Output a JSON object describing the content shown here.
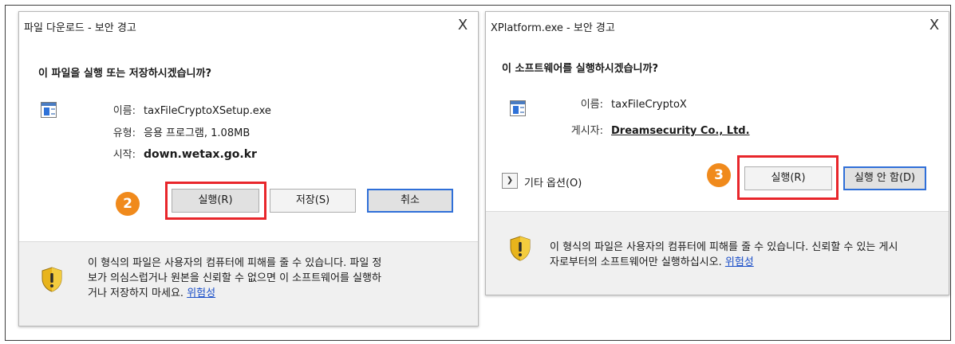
{
  "dialog1": {
    "title": "파일 다운로드 - 보안 경고",
    "close_glyph": "X",
    "question": "이 파일을 실행 또는 저장하시겠습니까?",
    "fields": [
      {
        "label": "이름:",
        "value": "taxFileCryptoXSetup.exe"
      },
      {
        "label": "유형:",
        "value": "응용 프로그램, 1.08MB"
      },
      {
        "label": "시작:",
        "value": "down.wetax.go.kr"
      }
    ],
    "step_number": "2",
    "buttons": {
      "run": "실행(R)",
      "save": "저장(S)",
      "cancel": "취소"
    },
    "warning_lines": [
      "이 형식의 파일은 사용자의 컴퓨터에 피해를 줄 수 있습니다. 파일 정",
      "보가 의심스럽거나 원본을 신뢰할 수 없으면 이 소프트웨어를 실행하",
      "거나 저장하지 마세요."
    ],
    "risk_link": "위험성"
  },
  "dialog2": {
    "title": "XPlatform.exe - 보안 경고",
    "close_glyph": "X",
    "question": "이 소프트웨어를 실행하시겠습니까?",
    "fields": [
      {
        "label": "이름:",
        "value": "taxFileCryptoX"
      },
      {
        "label": "게시자:",
        "value": "Dreamsecurity Co., Ltd."
      }
    ],
    "more_options_glyph": "❯",
    "more_options": "기타 옵션(O)",
    "step_number": "3",
    "buttons": {
      "run": "실행(R)",
      "dont_run": "실행 안 함(D)"
    },
    "warning_lines": [
      "이 형식의 파일은 사용자의 컴퓨터에 피해를 줄 수 있습니다. 신뢰할 수 있는 게시",
      "자로부터의 소프트웨어만 실행하십시오."
    ],
    "risk_link": "위험성"
  },
  "colors": {
    "highlight": "#e8262b",
    "step_badge": "#f08a1c",
    "link": "#1a4ec8",
    "default_button_border": "#2f6fd8",
    "shield_gold": "#e8b41c"
  }
}
